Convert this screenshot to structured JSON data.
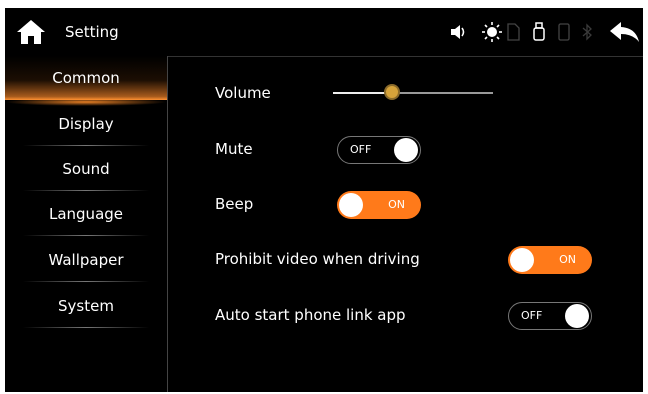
{
  "header": {
    "title": "Setting"
  },
  "status_icons": [
    "speaker-icon",
    "brightness-icon",
    "sd-card-icon",
    "usb-icon",
    "phone-icon",
    "bluetooth-icon"
  ],
  "sidebar": {
    "items": [
      {
        "label": "Common",
        "active": true
      },
      {
        "label": "Display"
      },
      {
        "label": "Sound"
      },
      {
        "label": "Language"
      },
      {
        "label": "Wallpaper"
      },
      {
        "label": "System"
      }
    ]
  },
  "settings": {
    "volume": {
      "label": "Volume",
      "level": 0.37
    },
    "mute": {
      "label": "Mute",
      "state": "OFF"
    },
    "beep": {
      "label": "Beep",
      "state": "ON"
    },
    "prohibit_video": {
      "label": "Prohibit video when driving",
      "state": "ON"
    },
    "auto_start": {
      "label": "Auto start phone link app",
      "state": "OFF"
    }
  },
  "colors": {
    "accent": "#ff7a1a",
    "background": "#000000",
    "knob": "#d6a33a"
  }
}
